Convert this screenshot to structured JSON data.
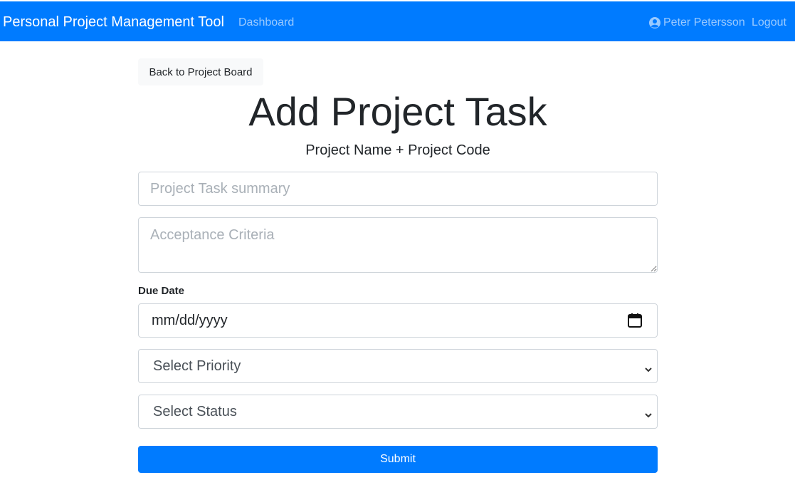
{
  "navbar": {
    "brand": "Personal Project Management Tool",
    "dashboard_label": "Dashboard",
    "user_name": "Peter Petersson",
    "logout_label": "Logout",
    "user_icon": "user-circle-icon"
  },
  "back_button_label": "Back to Project Board",
  "page": {
    "title": "Add Project Task",
    "subtitle": "Project Name + Project Code"
  },
  "form": {
    "summary_placeholder": "Project Task summary",
    "acceptance_placeholder": "Acceptance Criteria",
    "due_date_label": "Due Date",
    "due_date_placeholder": "mm/dd/yyyy",
    "priority_selected": "Select Priority",
    "status_selected": "Select Status",
    "submit_label": "Submit"
  },
  "colors": {
    "primary": "#007bff",
    "light_button": "#f8f9fa"
  }
}
